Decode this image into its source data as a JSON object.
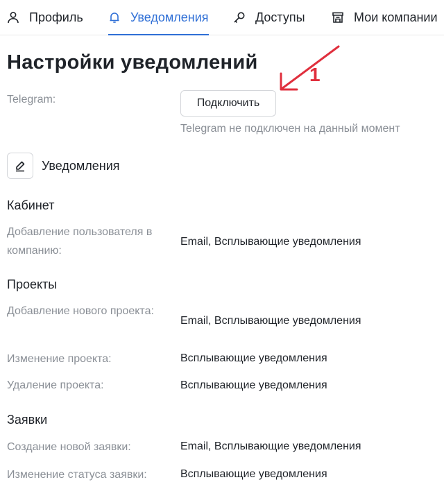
{
  "tabs": [
    {
      "label": "Профиль",
      "icon": "person-icon"
    },
    {
      "label": "Уведомления",
      "icon": "bell-icon",
      "active": true
    },
    {
      "label": "Доступы",
      "icon": "key-icon"
    },
    {
      "label": "Мои компании",
      "icon": "store-icon"
    }
  ],
  "page": {
    "title": "Настройки уведомлений"
  },
  "telegram": {
    "label": "Telegram:",
    "connect_label": "Подключить",
    "status": "Telegram не подключен на данный момент"
  },
  "notifications": {
    "heading": "Уведомления"
  },
  "sections": [
    {
      "title": "Кабинет",
      "rows": [
        {
          "label": "Добавление пользователя в компанию:",
          "value": "Email, Всплывающие уведомления"
        }
      ]
    },
    {
      "title": "Проекты",
      "rows": [
        {
          "label": "Добавление нового проекта:",
          "value": "Email, Всплывающие уведомления"
        },
        {
          "label": "Изменение проекта:",
          "value": "Всплывающие уведомления"
        },
        {
          "label": "Удаление проекта:",
          "value": "Всплывающие уведомления"
        }
      ]
    },
    {
      "title": "Заявки",
      "rows": [
        {
          "label": "Создание новой заявки:",
          "value": "Email, Всплывающие уведомления"
        },
        {
          "label": "Изменение статуса заявки:",
          "value": "Всплывающие уведомления"
        }
      ]
    }
  ],
  "annotation": {
    "number": "1",
    "color": "#e02f3d"
  },
  "colors": {
    "accent": "#2f6fd6",
    "muted_text": "#8a8f96",
    "text": "#1f2329"
  }
}
